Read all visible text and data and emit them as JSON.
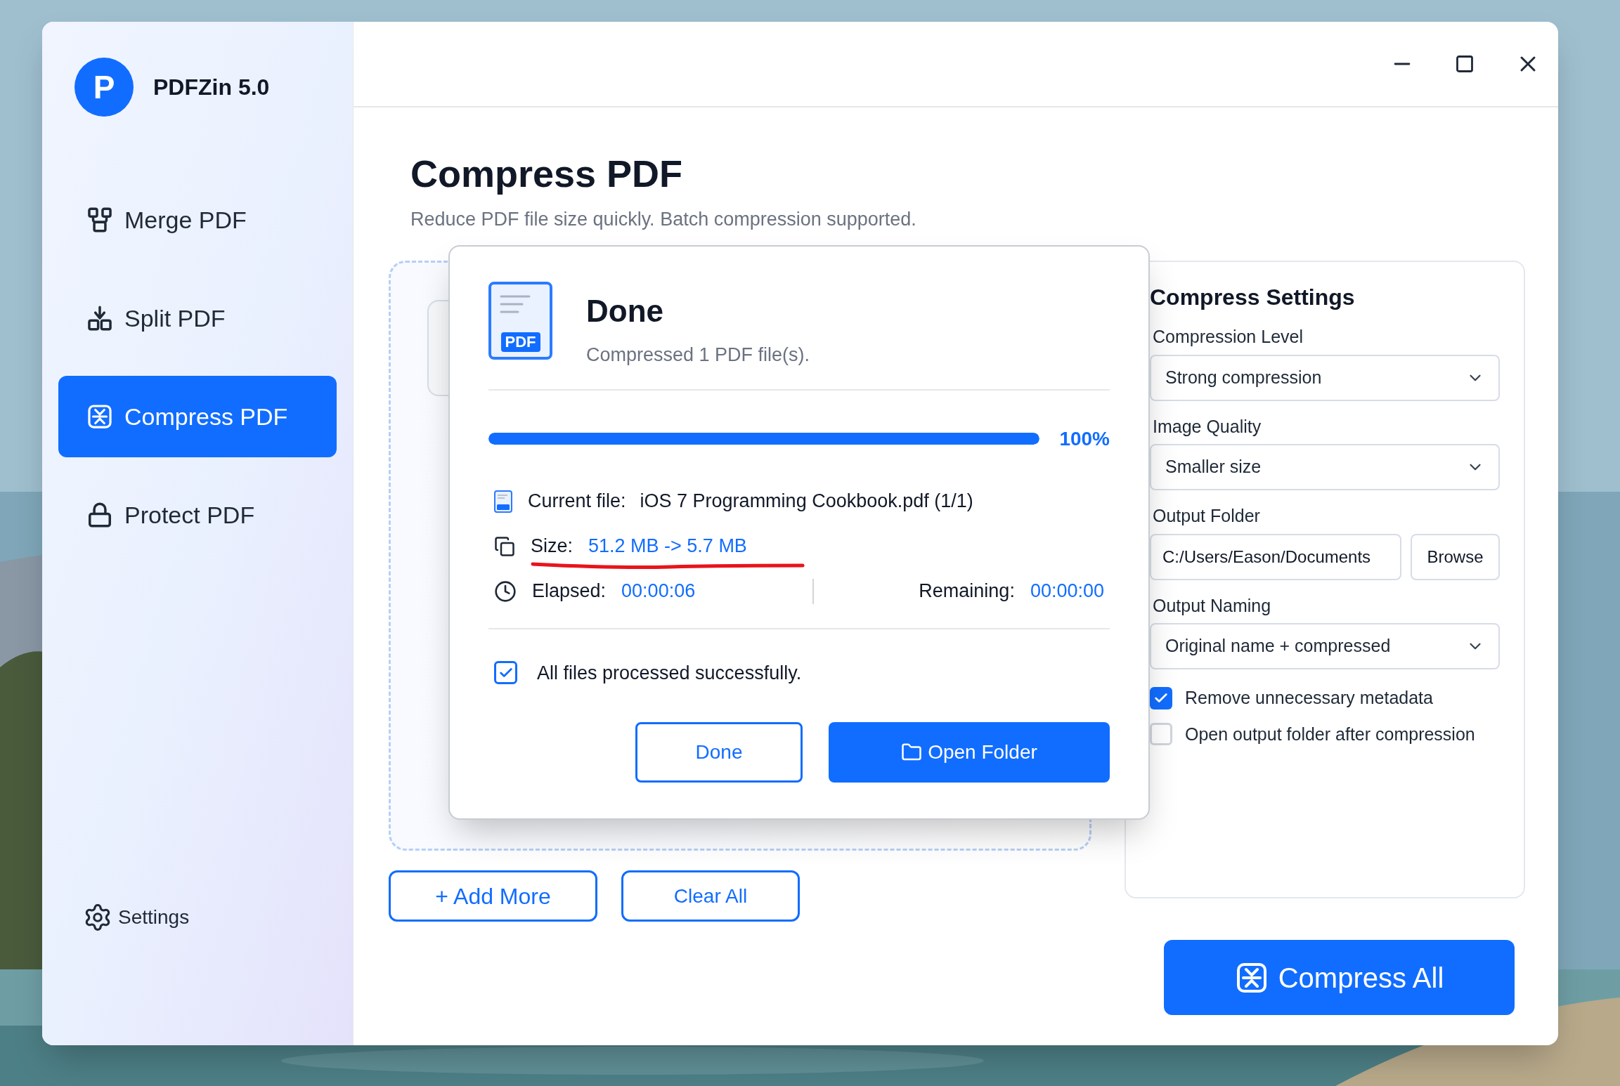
{
  "app": {
    "logo_letter": "P",
    "name": "PDFZin 5.0"
  },
  "sidebar": {
    "items": [
      {
        "label": "Merge PDF",
        "selected": false
      },
      {
        "label": "Split PDF",
        "selected": false
      },
      {
        "label": "Compress PDF",
        "selected": true
      },
      {
        "label": "Protect PDF",
        "selected": false
      }
    ],
    "settings": "Settings"
  },
  "page": {
    "title": "Compress PDF",
    "subtitle": "Reduce PDF file size quickly. Batch compression supported."
  },
  "file_buttons": [
    "+ Add More",
    "Clear All"
  ],
  "settings_panel": {
    "title": "Compress Settings",
    "compression_level": {
      "label": "Compression Level",
      "value": "Strong compression"
    },
    "image_quality": {
      "label": "Image Quality",
      "value": "Smaller size"
    },
    "output_folder": {
      "label": "Output Folder",
      "value": "C:/Users/Eason/Documents",
      "button": "Browse"
    },
    "output_naming": {
      "label": "Output Naming",
      "value": "Original name + compressed"
    },
    "options": [
      {
        "label": "Remove unnecessary metadata",
        "checked": true
      },
      {
        "label": "Open output folder after compression",
        "checked": false
      }
    ]
  },
  "compress_all": "Compress All",
  "dialog": {
    "icon_badge": "PDF",
    "title": "Done",
    "subtitle": "Compressed 1 PDF file(s).",
    "progress": {
      "level": 1,
      "reading": "100%"
    },
    "current_file": {
      "label": "Current file:",
      "value": "iOS 7 Programming Cookbook.pdf (1/1)"
    },
    "size": {
      "label": "Size:",
      "value": "51.2 MB -> 5.7 MB"
    },
    "elapsed": {
      "label": "Elapsed:",
      "value": "00:00:06"
    },
    "remaining": {
      "label": "Remaining:",
      "value": "00:00:00"
    },
    "status": {
      "label": "All files processed successfully.",
      "checked": true
    },
    "buttons": [
      "Done",
      "Open Folder"
    ]
  }
}
